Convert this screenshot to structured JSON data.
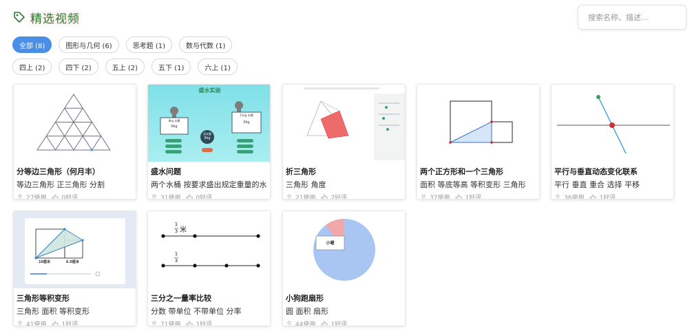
{
  "page": {
    "title": "精选视频"
  },
  "search": {
    "placeholder": "搜索名称、描述..."
  },
  "filters": {
    "categories": [
      {
        "label": "全部 (8)",
        "active": true
      },
      {
        "label": "图形与几何 (6)",
        "active": false
      },
      {
        "label": "思考题 (1)",
        "active": false
      },
      {
        "label": "数与代数 (1)",
        "active": false
      }
    ],
    "grades": [
      {
        "label": "四上 (2)"
      },
      {
        "label": "四下 (2)"
      },
      {
        "label": "五上 (2)"
      },
      {
        "label": "五下 (1)"
      },
      {
        "label": "六上 (1)"
      }
    ]
  },
  "cards": [
    {
      "title": "分等边三角形（何月丰）",
      "tags": "等边三角形 正三角形 分割",
      "uses": "27使用",
      "likes": "0好评"
    },
    {
      "title": "盛水问题",
      "tags": "两个水桶 按要求盛出规定重量的水",
      "uses": "31使用",
      "likes": "0好评",
      "thumb": {
        "heading": "盛水实验",
        "left_bucket": "8kg 水桶",
        "left_value": "0kg",
        "right_bucket": "11kg 水桶",
        "right_value": "0kg",
        "center_label": "总水量",
        "center_value": "0kg"
      }
    },
    {
      "title": "折三角形",
      "tags": "三角形 角度",
      "uses": "21使用",
      "likes": "2好评"
    },
    {
      "title": "两个正方形和一个三角形",
      "tags": "面积 等底等高 等积变形 三角形",
      "uses": "37使用",
      "likes": "1好评"
    },
    {
      "title": "平行与垂直动态变化联系",
      "tags": "平行 垂直 重合 选择 平移",
      "uses": "36使用",
      "likes": "1好评"
    },
    {
      "title": "三角形等积变形",
      "tags": "三角形 面积 等积变形",
      "uses": "41使用",
      "likes": "1好评",
      "thumb": {
        "label_left": "10厘米",
        "label_right": "6.0厘米"
      }
    },
    {
      "title": "三分之一量率比较",
      "tags": "分数 带单位 不带单位 分率",
      "uses": "71使用",
      "likes": "1好评",
      "thumb": {
        "fraction_num": "1",
        "fraction_den": "3",
        "unit": "米"
      }
    },
    {
      "title": "小狗跑扇形",
      "tags": "圆 面积 扇形",
      "uses": "44使用",
      "likes": "1好评",
      "thumb": {
        "box_label": "小喔"
      }
    }
  ],
  "colors": {
    "accent": "#4a8ee6",
    "title_green": "#2e7d32",
    "muted": "#999999"
  }
}
